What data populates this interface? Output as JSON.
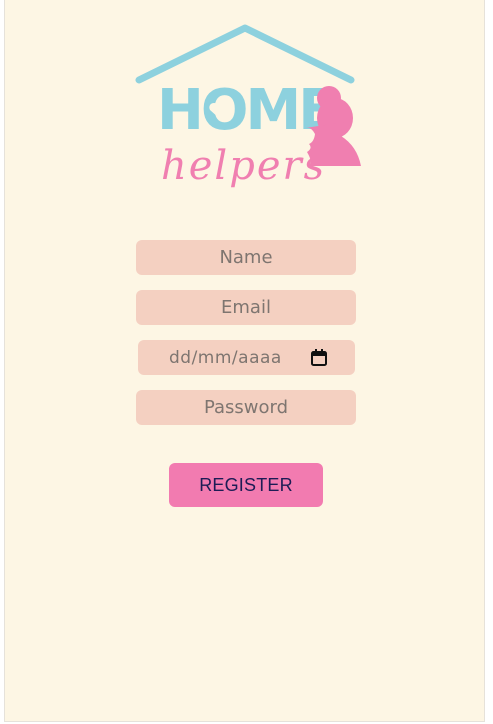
{
  "logo": {
    "word_top": "HOME",
    "word_bottom": "helpers"
  },
  "form": {
    "name_placeholder": "Name",
    "email_placeholder": "Email",
    "date_placeholder": "dd/mm/aaaa",
    "password_placeholder": "Password",
    "register_label": "REGISTER"
  },
  "colors": {
    "background": "#fdf6e4",
    "field": "#f4d0c1",
    "button": "#f27bb0",
    "logo_blue": "#8dd1de",
    "logo_pink": "#f07fb0"
  }
}
